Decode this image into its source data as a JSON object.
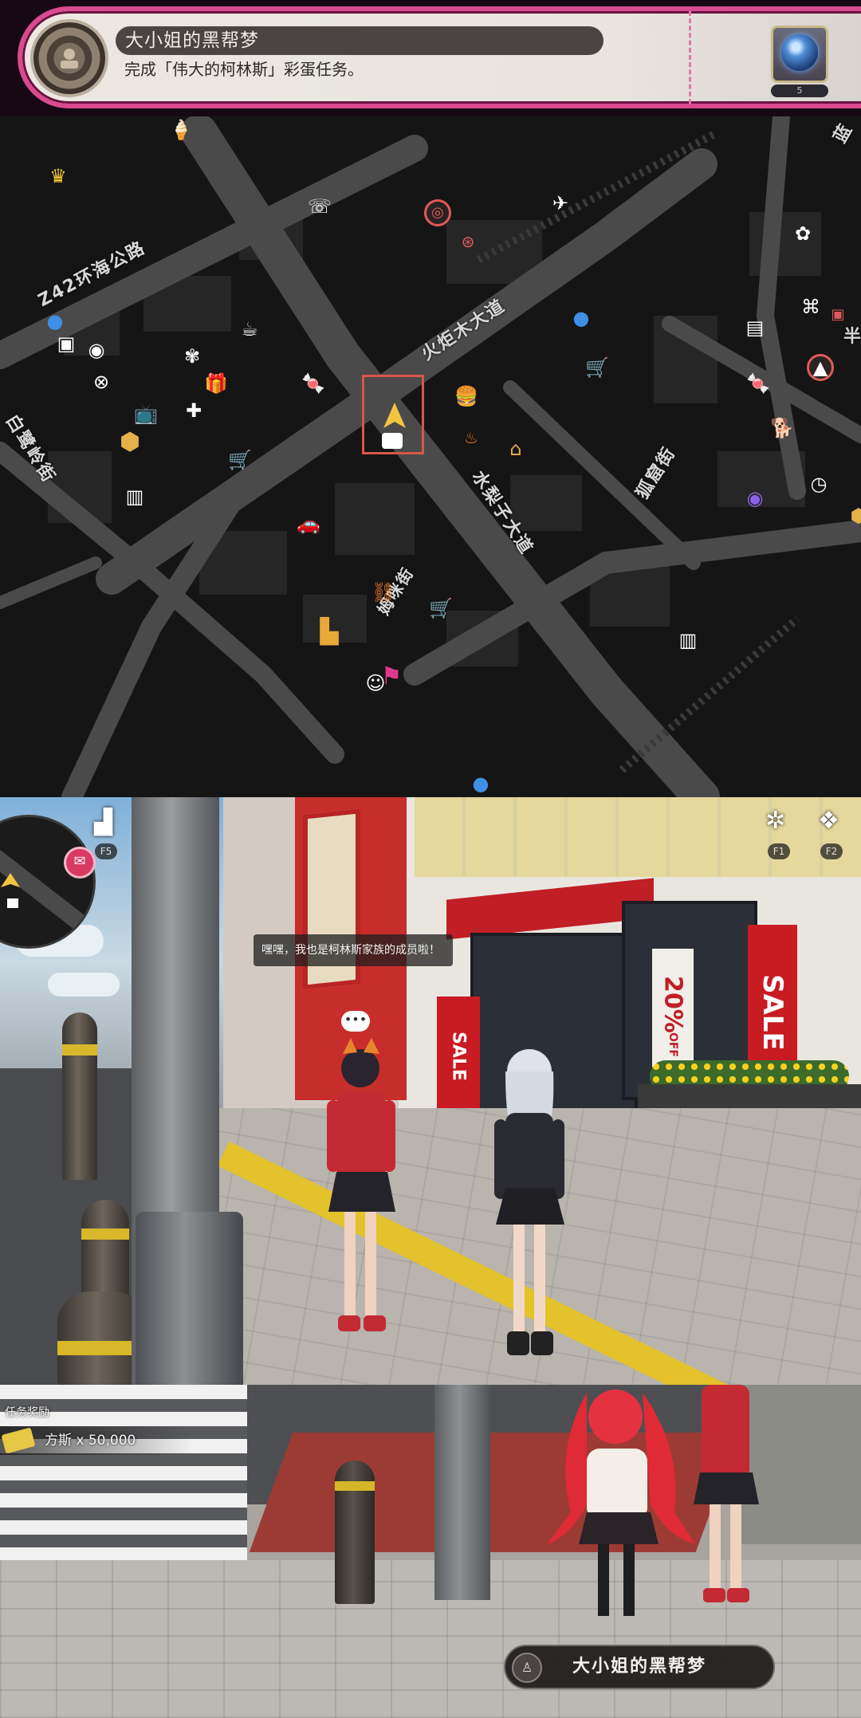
{
  "achievement": {
    "title": "大小姐的黑帮梦",
    "description": "完成「伟大的柯林斯」彩蛋任务。",
    "reward_count": "5",
    "icons": {
      "medal": "medal-icon",
      "reward": "polychrome-orb-icon"
    },
    "colors": {
      "border": "#d94a8e",
      "card": "#ece7e2"
    }
  },
  "map": {
    "street_labels": [
      "Z42环海公路",
      "火炬木大道",
      "水梨子大道",
      "白鹭岭街",
      "狐窟街",
      "姆咪街",
      "蓝",
      "半"
    ],
    "poi_icons": [
      "ice-cream-icon",
      "crown-shop-icon",
      "signal-icon",
      "hollow-zero-icon",
      "bangboo-icon",
      "coffee-icon",
      "flower-icon",
      "gift-icon",
      "health-icon",
      "tv-icon",
      "candy-icon",
      "burger-icon",
      "home-icon",
      "cart-icon",
      "car-icon",
      "arcade-icon",
      "newsstand-icon",
      "bookstore-icon",
      "dog-icon",
      "compass-icon",
      "character-icon",
      "chain-link-icon",
      "race-flag-icon"
    ],
    "player_marker": "player-arrow-icon"
  },
  "game_view": {
    "speech_text": "嘿嘿，我也是柯林斯家族的成员啦！",
    "speech_dots": "•••",
    "hud_keys": {
      "f5": "F5",
      "f1": "F1",
      "f2": "F2"
    },
    "store_signs": {
      "sale": "SALE",
      "discount": "20%",
      "off": "OFF"
    }
  },
  "bottom": {
    "reward_title": "任务奖励",
    "reward_item": "方斯 x 50,000",
    "quest_name": "大小姐的黑帮梦"
  }
}
